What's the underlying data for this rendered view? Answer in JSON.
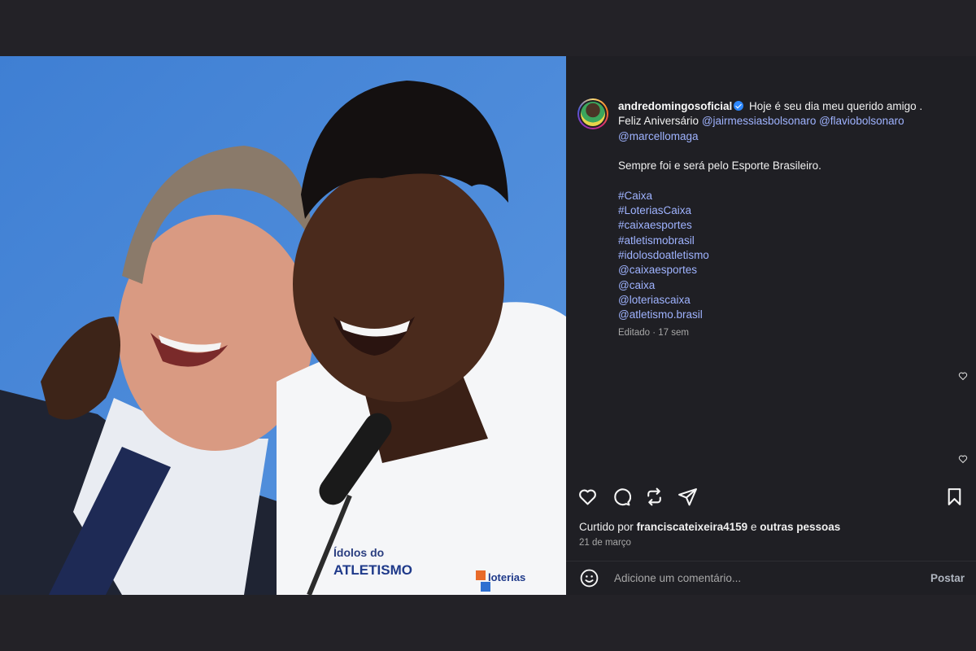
{
  "post": {
    "username": "andredomingosoficial",
    "caption_intro": "Hoje é seu dia meu querido amigo .",
    "caption_birthday": "Feliz Aniversário",
    "mentions_line": [
      "@jairmessiasbolsonaro",
      "@flaviobolsonaro",
      "@marcellomaga"
    ],
    "caption_body": "Sempre foi e será pelo Esporte Brasileiro.",
    "tags": [
      "#Caixa",
      "#LoteriasCaixa",
      "#caixaesportes",
      "#atletismobrasil",
      "#idolosdoatletismo",
      "@caixaesportes",
      "@caixa",
      "@loteriascaixa",
      "@atletismo.brasil"
    ],
    "edited": "Editado",
    "time_ago": "17 sem",
    "liked_by_prefix": "Curtido por",
    "liked_by_user": "franciscateixeira4159",
    "liked_by_and": "e",
    "liked_by_others": "outras pessoas",
    "date": "21 de março"
  },
  "image_text": {
    "shirt_logo": "Ídolos do ATLETISMO",
    "loterias": "loterias CAIXA"
  },
  "comment": {
    "placeholder": "Adicione um comentário...",
    "post_label": "Postar"
  },
  "icons": {
    "like": "heart-icon",
    "comment": "comment-icon",
    "repost": "repost-icon",
    "share": "share-icon",
    "save": "bookmark-icon",
    "emoji": "emoji-icon",
    "verified": "verified-badge-icon"
  },
  "colors": {
    "background": "#232227",
    "panel": "#1f1f24",
    "link": "#9fb3ff",
    "verified": "#2d88ff"
  }
}
